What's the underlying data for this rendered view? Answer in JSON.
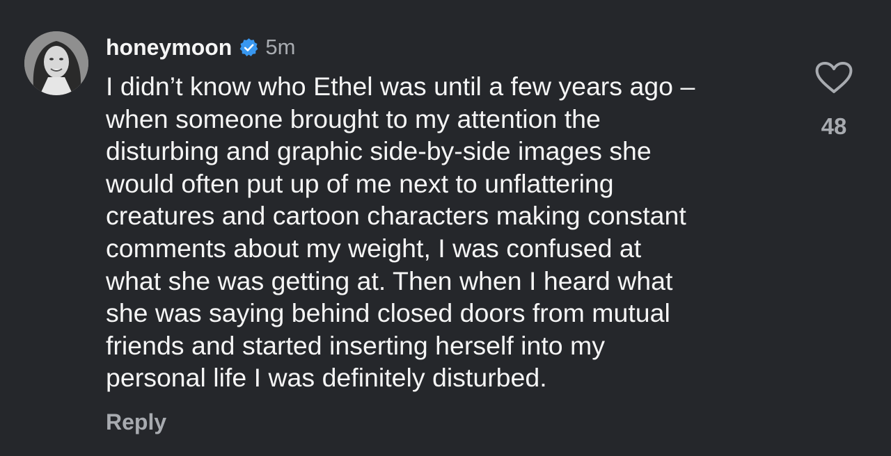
{
  "comment": {
    "username": "honeymoon",
    "verified": true,
    "timestamp": "5m",
    "avatar_icon": "profile-photo",
    "lines": [
      "I didn’t know who Ethel was until a few years ago –",
      "when someone brought to my attention the",
      "disturbing and graphic side-by-side images she",
      "would often put up of me next to unflattering",
      "creatures and cartoon characters making constant",
      "comments about my weight, I was confused at",
      "what she was getting at. Then when I heard what",
      "she was saying behind closed doors from mutual",
      "friends and started inserting herself into my",
      "personal life I was definitely disturbed."
    ],
    "reply_label": "Reply",
    "like_icon": "heart-outline-icon",
    "like_count": "48"
  },
  "colors": {
    "background": "#25272b",
    "text_primary": "#f5f5f5",
    "text_secondary": "#a8abb0",
    "verified_badge": "#3897f0"
  }
}
